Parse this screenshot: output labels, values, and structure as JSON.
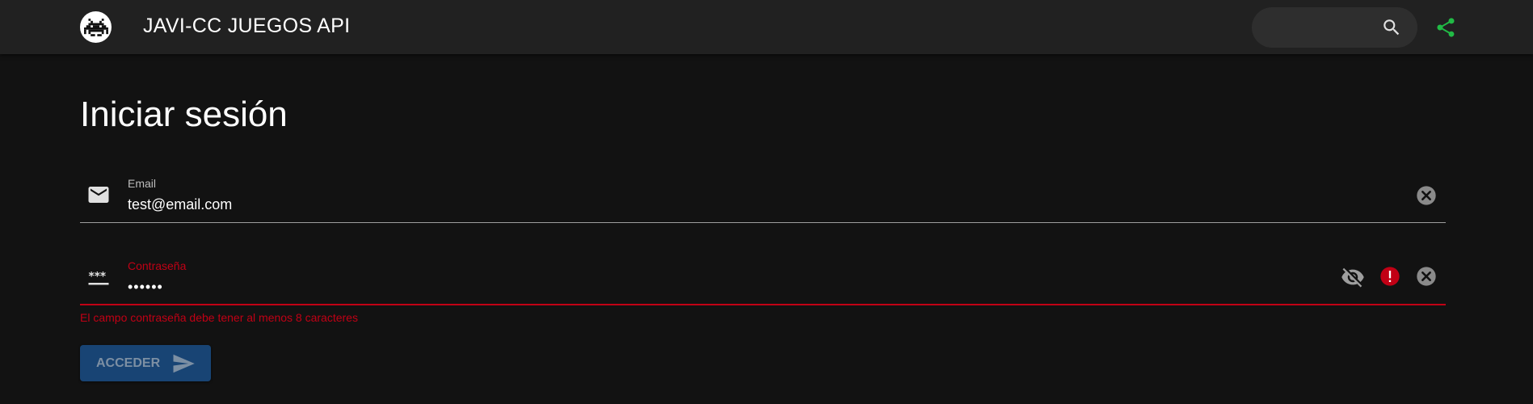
{
  "header": {
    "app_title": "JAVI-CC JUEGOS API",
    "logo_icon": "space-invader-icon",
    "search": {
      "placeholder": "",
      "value": ""
    },
    "share_icon": "share-icon",
    "accent_color": "#21ba45"
  },
  "login": {
    "title": "Iniciar sesión",
    "email": {
      "label": "Email",
      "value": "test@email.com",
      "icon": "mail-icon"
    },
    "password": {
      "label": "Contraseña",
      "value": "••••••",
      "icon": "password-icon"
    },
    "error_message": "El campo contraseña debe tener al menos 8 caracteres",
    "error_color": "#c10015",
    "submit_label": "ACCEDER"
  }
}
